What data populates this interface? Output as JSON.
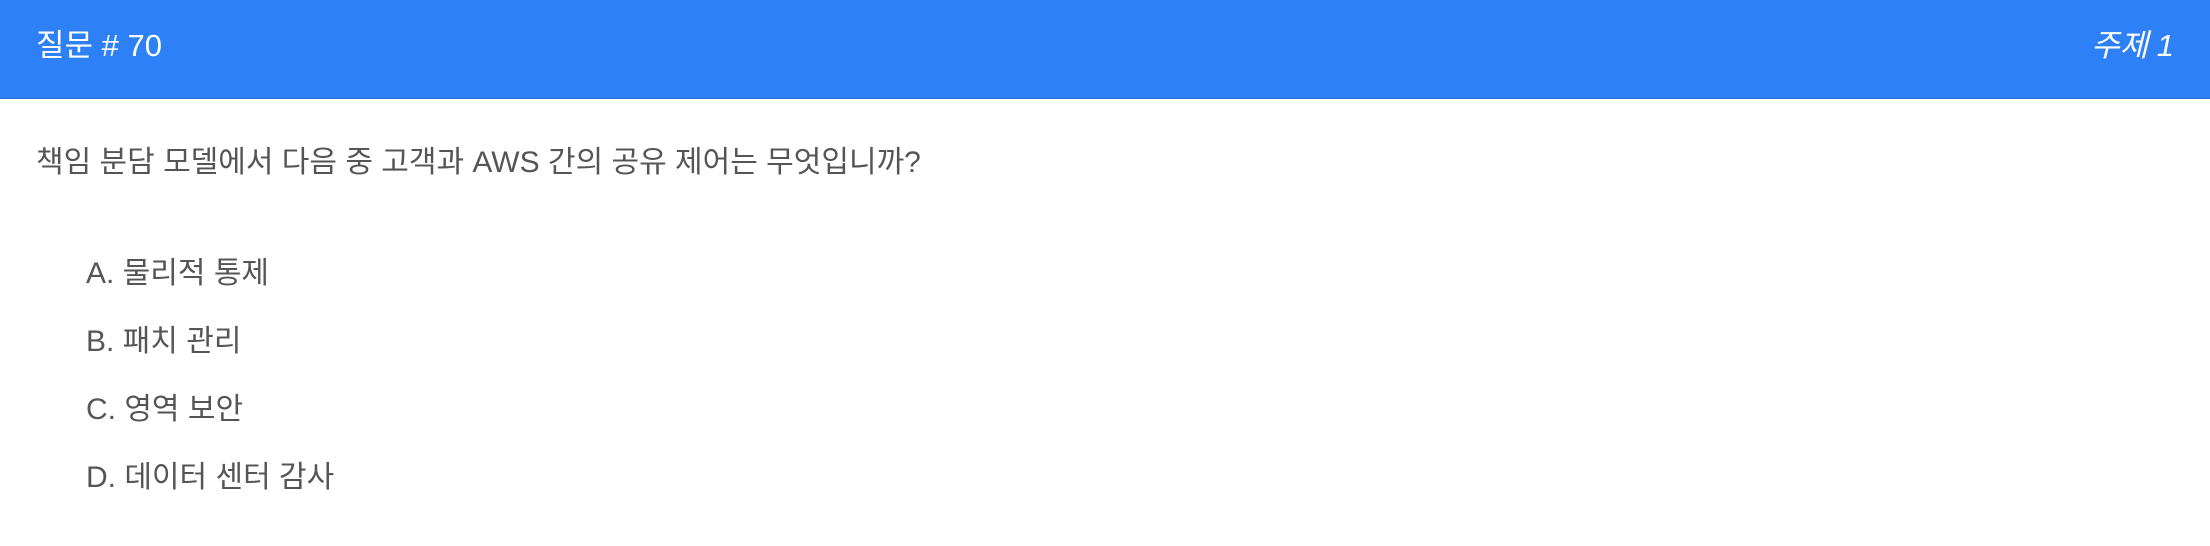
{
  "header": {
    "question_label": "질문 # 70",
    "topic_label": "주제 1"
  },
  "question": {
    "text": "책임 분담 모델에서 다음 중 고객과 AWS 간의 공유 제어는 무엇입니까?"
  },
  "choices": [
    {
      "text": "A. 물리적 통제"
    },
    {
      "text": "B. 패치 관리"
    },
    {
      "text": "C. 영역 보안"
    },
    {
      "text": "D. 데이터 센터 감사"
    }
  ],
  "colors": {
    "header_background": "#2d80f6",
    "header_text": "#ffffff",
    "body_text": "#555555"
  }
}
